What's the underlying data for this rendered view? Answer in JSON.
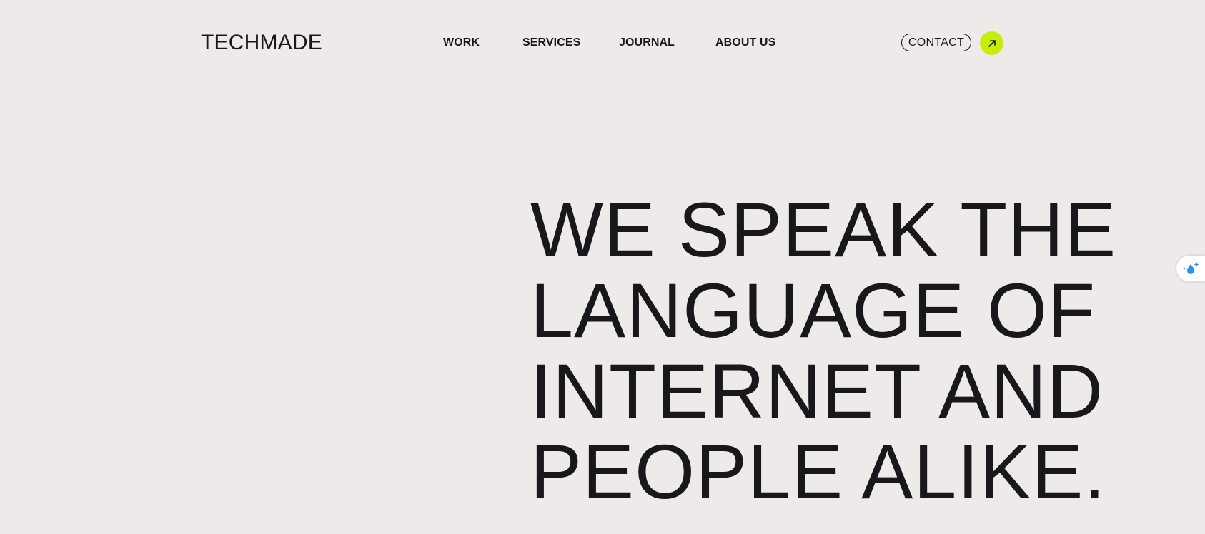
{
  "brand": {
    "logo": "TECHMADE"
  },
  "nav": {
    "items": [
      {
        "label": "WORK"
      },
      {
        "label": "SERVICES"
      },
      {
        "label": "JOURNAL"
      },
      {
        "label": "ABOUT US"
      }
    ]
  },
  "cta": {
    "contact_label": "CONTACT",
    "arrow_icon": "arrow-up-right-icon",
    "accent_color": "#c6ee0b"
  },
  "hero": {
    "lines": [
      "WE SPEAK THE",
      "LANGUAGE OF",
      "INTERNET AND",
      "PEOPLE ALIKE."
    ]
  },
  "extension_widget": {
    "icon": "sparkle-drop-icon"
  },
  "colors": {
    "background": "#eeeae9",
    "text": "#17171c"
  }
}
